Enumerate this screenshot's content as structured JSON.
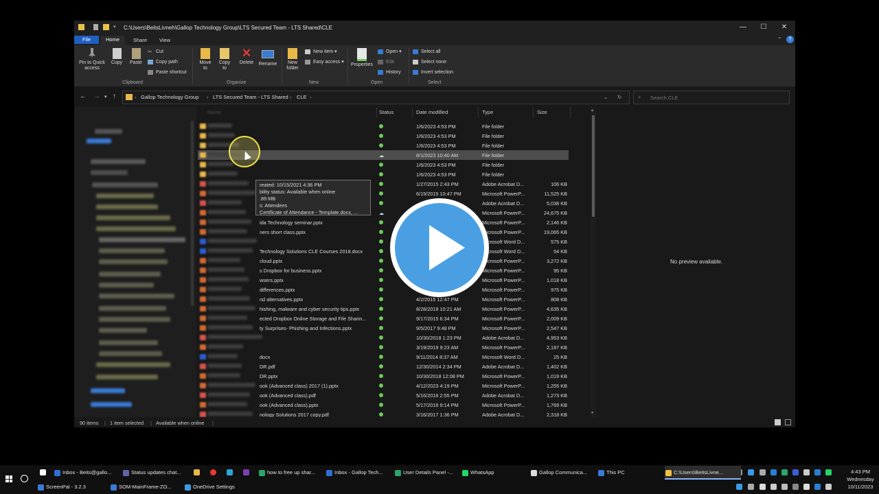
{
  "window": {
    "title": "C:\\Users\\BeitsLivneh\\Gallop Technology Group\\LTS Secured Team - LTS Shared\\CLE",
    "controls": {
      "minimize": "—",
      "maximize": "☐",
      "close": "✕"
    }
  },
  "ribbon_tabs": [
    "File",
    "Home",
    "Share",
    "View"
  ],
  "ribbon": {
    "pin": "Pin to Quick access",
    "copy": "Copy",
    "paste": "Paste",
    "cut": "Cut",
    "copy_path": "Copy path",
    "paste_shortcut": "Paste shortcut",
    "move_to": "Move to",
    "copy_to": "Copy to",
    "delete": "Delete",
    "rename": "Rename",
    "new_folder": "New folder",
    "new_item": "New item",
    "easy_access": "Easy access",
    "properties": "Properties",
    "open": "Open",
    "edit": "Edit",
    "history": "History",
    "select_all": "Select all",
    "select_none": "Select none",
    "invert_selection": "Invert selection",
    "groups": {
      "clipboard": "Clipboard",
      "organize": "Organize",
      "new": "New",
      "open": "Open",
      "select": "Select"
    }
  },
  "address": {
    "crumbs": [
      "Gallop Technology Group",
      "LTS Secured Team - LTS Shared",
      "CLE"
    ],
    "search_placeholder": "Search CLE"
  },
  "columns": {
    "name": "Name",
    "status": "Status",
    "date": "Date modified",
    "type": "Type",
    "size": "Size"
  },
  "files": [
    {
      "name": "",
      "status": "synced",
      "date": "1/6/2023 4:53 PM",
      "type": "File folder",
      "size": ""
    },
    {
      "name": "",
      "status": "synced",
      "date": "1/6/2023 4:53 PM",
      "type": "File folder",
      "size": ""
    },
    {
      "name": "",
      "status": "synced",
      "date": "1/6/2023 4:53 PM",
      "type": "File folder",
      "size": ""
    },
    {
      "name": "",
      "status": "cloud",
      "date": "8/1/2023 10:40 AM",
      "type": "File folder",
      "size": "",
      "selected": true
    },
    {
      "name": "",
      "status": "synced",
      "date": "1/6/2023 4:53 PM",
      "type": "File folder",
      "size": ""
    },
    {
      "name": "",
      "status": "synced",
      "date": "1/6/2023 4:53 PM",
      "type": "File folder",
      "size": ""
    },
    {
      "name": "",
      "status": "synced",
      "date": "1/27/2015 2:43 PM",
      "type": "Adobe Acrobat D...",
      "size": "106 KB"
    },
    {
      "name": "",
      "status": "synced",
      "date": "6/19/2015 10:47 PM",
      "type": "Microsoft PowerP...",
      "size": "11,525 KB"
    },
    {
      "name": "21.pdf",
      "status": "synced",
      "date": "",
      "type": "Adobe Acrobat D...",
      "size": "5,038 KB"
    },
    {
      "name": "21.pptx",
      "status": "cloud",
      "date": "",
      "type": "Microsoft PowerP...",
      "size": "24,675 KB"
    },
    {
      "name": "ida Technology seminar.pptx",
      "status": "synced",
      "date": "",
      "type": "Microsoft PowerP...",
      "size": "2,146 KB"
    },
    {
      "name": "ners short class.pptx",
      "status": "synced",
      "date": "",
      "type": "Microsoft PowerP...",
      "size": "19,065 KB"
    },
    {
      "name": "",
      "status": "synced",
      "date": "",
      "type": "Microsoft Word D...",
      "size": "575 KB"
    },
    {
      "name": "Technology Solutions CLE Courses 2018.docx",
      "status": "synced",
      "date": "",
      "type": "Microsoft Word D...",
      "size": "54 KB"
    },
    {
      "name": "cloud.pptx",
      "status": "synced",
      "date": "",
      "type": "Microsoft PowerP...",
      "size": "3,272 KB"
    },
    {
      "name": "s Dropbox for business.pptx",
      "status": "synced",
      "date": "",
      "type": "Microsoft PowerP...",
      "size": "95 KB"
    },
    {
      "name": "wsers.pptx",
      "status": "synced",
      "date": "",
      "type": "Microsoft PowerP...",
      "size": "1,018 KB"
    },
    {
      "name": "differences.pptx",
      "status": "synced",
      "date": "",
      "type": "Microsoft PowerP...",
      "size": "975 KB"
    },
    {
      "name": "nd alternatives.pptx",
      "status": "synced",
      "date": "4/2/2015 12:47 PM",
      "type": "Microsoft PowerP...",
      "size": "808 KB"
    },
    {
      "name": "hishing, malware and cyber security tips.pptx",
      "status": "synced",
      "date": "8/28/2019 10:21 AM",
      "type": "Microsoft PowerP...",
      "size": "4,635 KB"
    },
    {
      "name": "ected Dropbox Online Storage and File Sharin...",
      "status": "synced",
      "date": "9/17/2015 6:34 PM",
      "type": "Microsoft PowerP...",
      "size": "2,009 KB"
    },
    {
      "name": "ty Surprises- Phishing and Infections.pptx",
      "status": "synced",
      "date": "9/5/2017 9:48 PM",
      "type": "Microsoft PowerP...",
      "size": "2,547 KB"
    },
    {
      "name": "",
      "status": "synced",
      "date": "10/30/2018 1:23 PM",
      "type": "Adobe Acrobat D...",
      "size": "4,953 KB"
    },
    {
      "name": "",
      "status": "synced",
      "date": "3/19/2019 9:23 AM",
      "type": "Microsoft PowerP...",
      "size": "2,187 KB"
    },
    {
      "name": "docx",
      "status": "synced",
      "date": "9/11/2014 8:37 AM",
      "type": "Microsoft Word D...",
      "size": "25 KB"
    },
    {
      "name": "DR.pdf",
      "status": "synced",
      "date": "12/30/2014 2:34 PM",
      "type": "Adobe Acrobat D...",
      "size": "1,402 KB"
    },
    {
      "name": "DR.pptx",
      "status": "synced",
      "date": "10/30/2018 12:08 PM",
      "type": "Microsoft PowerP...",
      "size": "1,019 KB"
    },
    {
      "name": "ook (Advanced class) 2017 (1).pptx",
      "status": "synced",
      "date": "4/12/2023 4:19 PM",
      "type": "Microsoft PowerP...",
      "size": "1,255 KB"
    },
    {
      "name": "ook (Advanced class).pdf",
      "status": "synced",
      "date": "5/16/2016 2:55 PM",
      "type": "Adobe Acrobat D...",
      "size": "1,273 KB"
    },
    {
      "name": "ook (Advanced class).pptx",
      "status": "synced",
      "date": "5/17/2016 9:14 PM",
      "type": "Microsoft PowerP...",
      "size": "1,769 KB"
    },
    {
      "name": "nology Solutions 2017 copy.pdf",
      "status": "synced",
      "date": "3/16/2017 1:36 PM",
      "type": "Adobe Acrobat D...",
      "size": "2,318 KB"
    }
  ],
  "tooltip": {
    "line1": "reated: 10/15/2021 4:36 PM",
    "line2": "bility status: Available when online",
    "line3": ".89 MB",
    "line4": "s: Attendees",
    "line5": "Certificate of Attendance - Template.docx, ..."
  },
  "preview_text": "No preview available.",
  "statusbar": {
    "items": "90 items",
    "selected": "1 item selected",
    "availability": "Available when online"
  },
  "taskbar": {
    "row1": [
      {
        "label": "Inbox - Beits@gallo...",
        "color": "#2f6fd6"
      },
      {
        "label": "Status updates chat...",
        "color": "#6264a7"
      },
      {
        "label": "how to free up shar...",
        "color": "#2aa66a"
      },
      {
        "label": "Inbox - Gallop Tech...",
        "color": "#2f6fd6"
      },
      {
        "label": "User Details Panel -...",
        "color": "#2aa66a"
      },
      {
        "label": "WhatsApp",
        "color": "#25d366"
      },
      {
        "label": "Gallop Communica...",
        "color": "#dddddd"
      },
      {
        "label": "This PC",
        "color": "#3a7bd5"
      },
      {
        "label": "C:\\Users\\BeitsLivne...",
        "color": "#f0c040"
      }
    ],
    "row2": [
      {
        "label": "ScreenPal - 3.2.3",
        "color": "#3a7bd5"
      },
      {
        "label": "SOM-MainFrame-ZO...",
        "color": "#3a7bd5"
      },
      {
        "label": "OneDrive Settings",
        "color": "#3a9ae5"
      }
    ],
    "clock_time": "4:43 PM",
    "clock_day": "Wednesday",
    "clock_date": "10/11/2023"
  },
  "colors": {
    "accent": "#4a9fe2",
    "synced": "#6ecb5a",
    "selected_row": "#4d4d4d",
    "folder": "#e8b84a"
  }
}
